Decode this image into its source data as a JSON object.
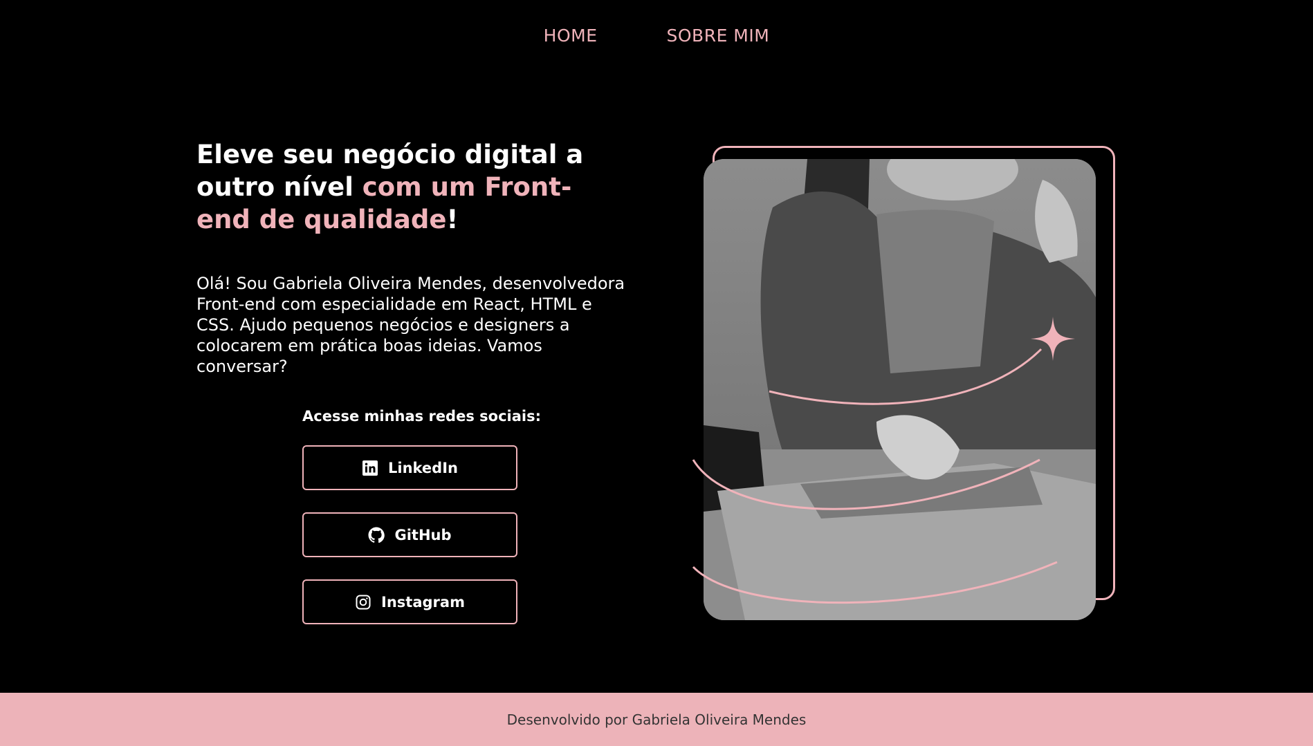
{
  "nav": {
    "home": "HOME",
    "about": "SOBRE MIM"
  },
  "hero": {
    "headline_part1": "Eleve seu negócio digital a outro nível ",
    "headline_accent": "com um Front-end de qualidade",
    "headline_end": "!",
    "intro": "Olá! Sou Gabriela Oliveira Mendes, desenvolvedora Front-end com especialidade em React, HTML e CSS. Ajudo pequenos negócios e designers a colocarem em prática boas ideias. Vamos conversar?"
  },
  "social": {
    "title": "Acesse minhas redes sociais:",
    "buttons": [
      {
        "label": "LinkedIn",
        "icon": "linkedin-icon"
      },
      {
        "label": "GitHub",
        "icon": "github-icon"
      },
      {
        "label": "Instagram",
        "icon": "instagram-icon"
      }
    ]
  },
  "footer": {
    "text": "Desenvolvido por Gabriela Oliveira Mendes"
  },
  "colors": {
    "background": "#000000",
    "accent": "#f0b3ba",
    "footer_bg": "#edb3b9"
  }
}
